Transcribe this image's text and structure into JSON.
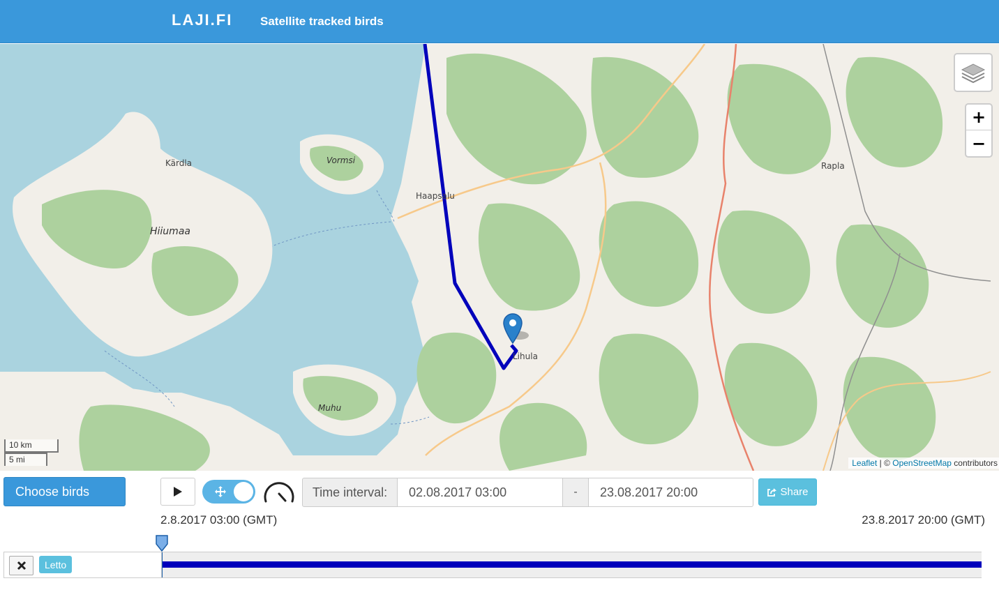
{
  "header": {
    "brand": "LAJI.FI",
    "subtitle": "Satellite tracked birds"
  },
  "map": {
    "place_labels": {
      "kardla": "Kärdla",
      "vormsi": "Vormsi",
      "haapsalu": "Haapsalu",
      "hiiumaa": "Hiiumaa",
      "rapla": "Rapla",
      "lihula": "Lihula",
      "muhu": "Muhu"
    },
    "scale": {
      "km": "10 km",
      "mi": "5 mi"
    },
    "attribution": {
      "leaflet": "Leaflet",
      "separator": " | © ",
      "osm": "OpenStreetMap",
      "suffix": " contributors"
    },
    "track_color": "#0000bb",
    "zoom_in": "+",
    "zoom_out": "−"
  },
  "controls": {
    "choose_birds": "Choose birds",
    "time_interval_label": "Time interval:",
    "from": "02.08.2017 03:00",
    "dash": "-",
    "to": "23.08.2017 20:00",
    "share": "Share"
  },
  "timeline": {
    "start": "2.8.2017 03:00 (GMT)",
    "end": "23.8.2017 20:00 (GMT)",
    "birds": [
      {
        "name": "Letto"
      }
    ]
  },
  "colors": {
    "header": "#3a98db",
    "accent": "#5bc0de",
    "track": "#0000bb"
  }
}
